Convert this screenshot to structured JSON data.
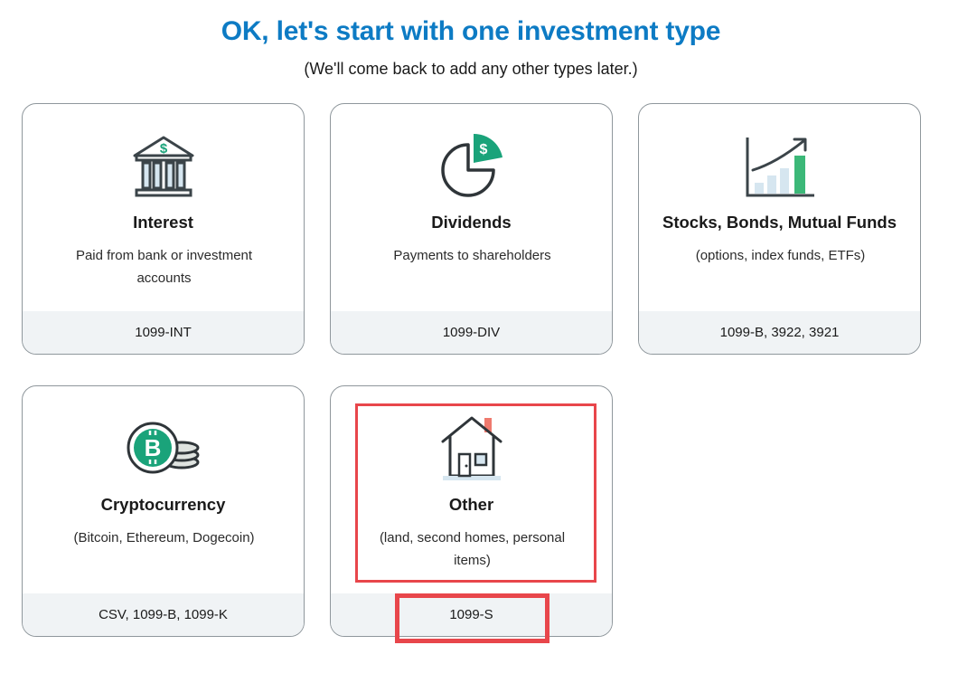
{
  "header": {
    "title": "OK, let's start with one investment type",
    "subtitle": "(We'll come back to add any other types later.)"
  },
  "cards": [
    {
      "icon": "bank-icon",
      "title": "Interest",
      "description": "Paid from bank or investment accounts",
      "forms": "1099-INT"
    },
    {
      "icon": "pie-chart-dollar-icon",
      "title": "Dividends",
      "description": "Payments to shareholders",
      "forms": "1099-DIV"
    },
    {
      "icon": "bar-chart-growth-icon",
      "title": "Stocks, Bonds, Mutual Funds",
      "description": "(options, index funds, ETFs)",
      "forms": "1099-B, 3922, 3921"
    },
    {
      "icon": "bitcoin-coins-icon",
      "title": "Cryptocurrency",
      "description": "(Bitcoin, Ethereum, Dogecoin)",
      "forms": "CSV, 1099-B, 1099-K"
    },
    {
      "icon": "house-icon",
      "title": "Other",
      "description": "(land, second homes, personal items)",
      "forms": "1099-S"
    }
  ],
  "colors": {
    "title": "#0d7bc4",
    "accent_green": "#1aa37a",
    "highlight": "#e8464b",
    "footer_bg": "#f0f3f5"
  }
}
